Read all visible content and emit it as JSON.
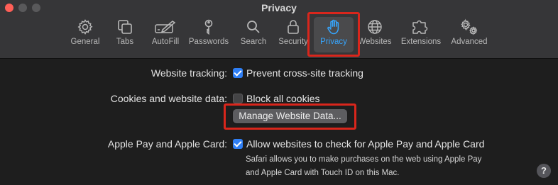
{
  "window": {
    "title": "Privacy"
  },
  "toolbar": {
    "panes": [
      {
        "label": "General",
        "icon": "gear-icon"
      },
      {
        "label": "Tabs",
        "icon": "tabs-icon"
      },
      {
        "label": "AutoFill",
        "icon": "autofill-pencil-icon"
      },
      {
        "label": "Passwords",
        "icon": "key-icon"
      },
      {
        "label": "Search",
        "icon": "magnifier-icon"
      },
      {
        "label": "Security",
        "icon": "lock-icon"
      },
      {
        "label": "Privacy",
        "icon": "hand-icon",
        "selected": true
      },
      {
        "label": "Websites",
        "icon": "globe-icon"
      },
      {
        "label": "Extensions",
        "icon": "puzzle-icon"
      },
      {
        "label": "Advanced",
        "icon": "gears-icon"
      }
    ]
  },
  "settings": {
    "tracking": {
      "label": "Website tracking:",
      "option": "Prevent cross-site tracking",
      "checked": true
    },
    "cookies": {
      "label": "Cookies and website data:",
      "option": "Block all cookies",
      "checked": false,
      "button": "Manage Website Data..."
    },
    "applepay": {
      "label": "Apple Pay and Apple Card:",
      "option": "Allow websites to check for Apple Pay and Apple Card",
      "checked": true,
      "note_line1": "Safari allows you to make purchases on the web using Apple Pay",
      "note_line2": "and Apple Card with Touch ID on this Mac."
    }
  },
  "help": {
    "label": "?"
  },
  "colors": {
    "accent": "#2f7ff5",
    "highlight": "#d9261c",
    "selected_text": "#36a6ff",
    "background": "#1e1e1e",
    "toolbar": "#363638"
  }
}
